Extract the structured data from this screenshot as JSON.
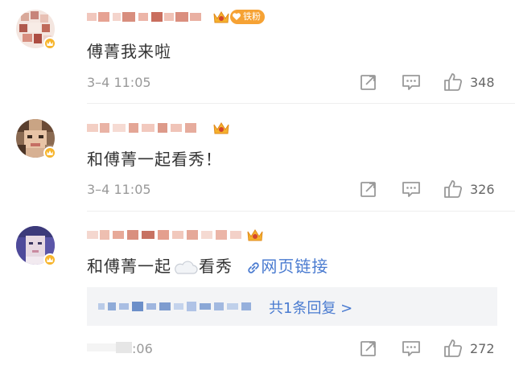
{
  "comments": [
    {
      "badge": "铁粉",
      "text": "傅菁我来啦",
      "time": "3–4 11:05",
      "likes": "348"
    },
    {
      "text": "和傅菁一起看秀！",
      "time": "3–4 11:05",
      "likes": "326"
    },
    {
      "text_before": "和傅菁一起",
      "text_after": "看秀",
      "link": "网页链接",
      "reply_summary": "共1条回复 >",
      "time": ":06",
      "likes": "272"
    }
  ],
  "colors": {
    "link": "#4a7bd0",
    "badge": "#f6a234",
    "vip": "#f7b52c"
  },
  "icons": [
    "share-icon",
    "comment-icon",
    "like-icon",
    "crown-icon",
    "link-icon",
    "cloud-emoji-icon"
  ]
}
